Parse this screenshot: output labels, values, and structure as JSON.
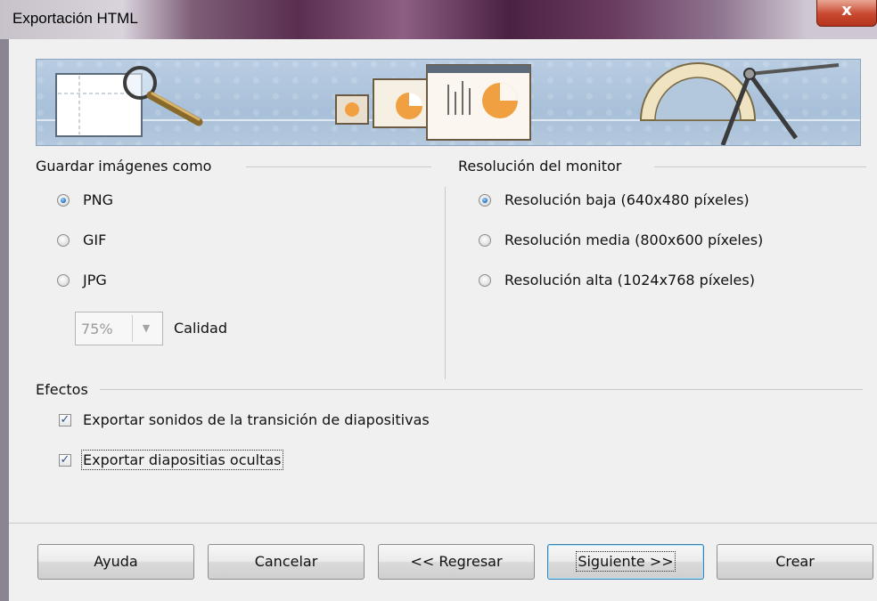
{
  "window": {
    "title": "Exportación HTML",
    "close_glyph": "x"
  },
  "image_section": {
    "header": "Guardar imágenes como",
    "options": [
      {
        "label": "PNG",
        "checked": true
      },
      {
        "label": "GIF",
        "checked": false
      },
      {
        "label": "JPG",
        "checked": false
      }
    ],
    "quality_value": "75%",
    "quality_label": "Calidad"
  },
  "resolution_section": {
    "header": "Resolución del monitor",
    "options": [
      {
        "label": "Resolución baja (640x480 píxeles)",
        "checked": true
      },
      {
        "label": "Resolución media (800x600 píxeles)",
        "checked": false
      },
      {
        "label": "Resolución alta (1024x768 píxeles)",
        "checked": false
      }
    ]
  },
  "effects_section": {
    "header": "Efectos",
    "checkboxes": [
      {
        "label": "Exportar sonidos de la transición de diapositivas",
        "checked": true
      },
      {
        "label": "Exportar diapositias ocultas",
        "checked": true
      }
    ]
  },
  "buttons": {
    "help": "Ayuda",
    "cancel": "Cancelar",
    "back": "<< Regresar",
    "next": "Siguiente >>",
    "create": "Crear"
  },
  "icons": {
    "banner_left": "magnifier-page-icon",
    "banner_center": "slides-chart-icon",
    "banner_right": "protractor-compass-icon",
    "check_glyph": "✓",
    "combo_arrow": "▼"
  },
  "colors": {
    "dialog_bg": "#f0f0f0",
    "banner_blue": "#a8c0d9",
    "close_red": "#c9482f",
    "radio_dot": "#1f6fc4",
    "default_button_border": "#3c7fb1"
  }
}
